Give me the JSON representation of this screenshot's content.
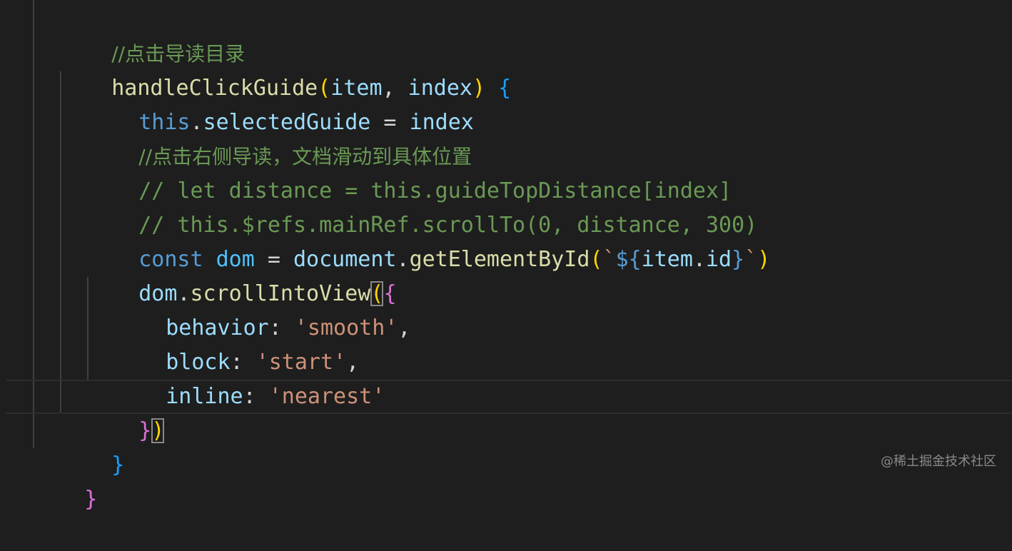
{
  "colors": {
    "background": "#1e1e1e",
    "comment": "#6a9955",
    "function": "#dcdcaa",
    "variable": "#9cdcfe",
    "keyword": "#569cd6",
    "constant": "#4fc1ff",
    "string": "#ce9178",
    "plain": "#d4d4d4",
    "bracket_gold": "#ffd700",
    "bracket_purple": "#da70d6",
    "bracket_blue": "#179fff"
  },
  "code": {
    "line01": [
      "//点击导读目录"
    ],
    "line02": [
      "handleClickGuide",
      "(",
      "item",
      ", ",
      "index",
      ") ",
      "{"
    ],
    "line03": [
      "this",
      ".",
      "selectedGuide",
      " = ",
      "index"
    ],
    "line04": [
      "//点击右侧导读，文档滑动到具体位置"
    ],
    "line05": [
      "// let distance = this.guideTopDistance[index]"
    ],
    "line06": [
      "// this.$refs.mainRef.scrollTo(0, distance, 300)"
    ],
    "line07": [
      "const",
      " ",
      "dom",
      " = ",
      "document",
      ".",
      "getElementById",
      "(",
      "`",
      "${",
      "item",
      ".",
      "id",
      "}",
      "`",
      ")"
    ],
    "line08": [
      "dom",
      ".",
      "scrollIntoView",
      "(",
      "{"
    ],
    "line09": [
      "behavior",
      ": ",
      "'smooth'",
      ","
    ],
    "line10": [
      "block",
      ": ",
      "'start'",
      ","
    ],
    "line11": [
      "inline",
      ": ",
      "'nearest'"
    ],
    "line12": [
      "}",
      ")"
    ],
    "line13": [
      "}"
    ],
    "line14": [
      "}"
    ]
  },
  "watermark": "@稀土掘金技术社区"
}
